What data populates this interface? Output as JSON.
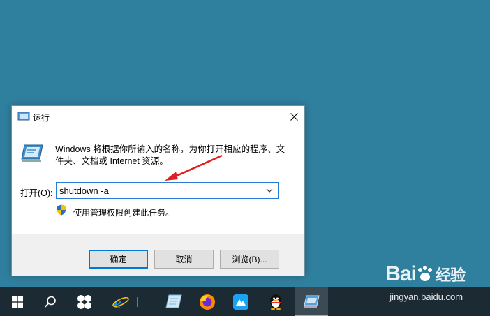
{
  "dialog": {
    "title": "运行",
    "description": "Windows 将根据你所输入的名称，为你打开相应的程序、文件夹、文档或 Internet 资源。",
    "open_label": "打开(O):",
    "command_value": "shutdown -a",
    "admin_note": "使用管理权限创建此任务。",
    "ok_label": "确定",
    "cancel_label": "取消",
    "browse_label": "浏览(B)..."
  },
  "taskbar": {
    "items": [
      "start-icon",
      "search-icon",
      "app-icon",
      "internet-explorer-icon",
      "notepad-icon",
      "firefox-icon",
      "app-store-icon",
      "qq-icon",
      "run-icon"
    ]
  },
  "watermark": {
    "logo_text": "Bai",
    "logo_suffix": "经验",
    "url": "jingyan.baidu.com"
  },
  "colors": {
    "desktop": "#2f7f9e",
    "taskbar": "#1c2a33",
    "accent": "#0078d7",
    "arrow": "#e02020"
  }
}
